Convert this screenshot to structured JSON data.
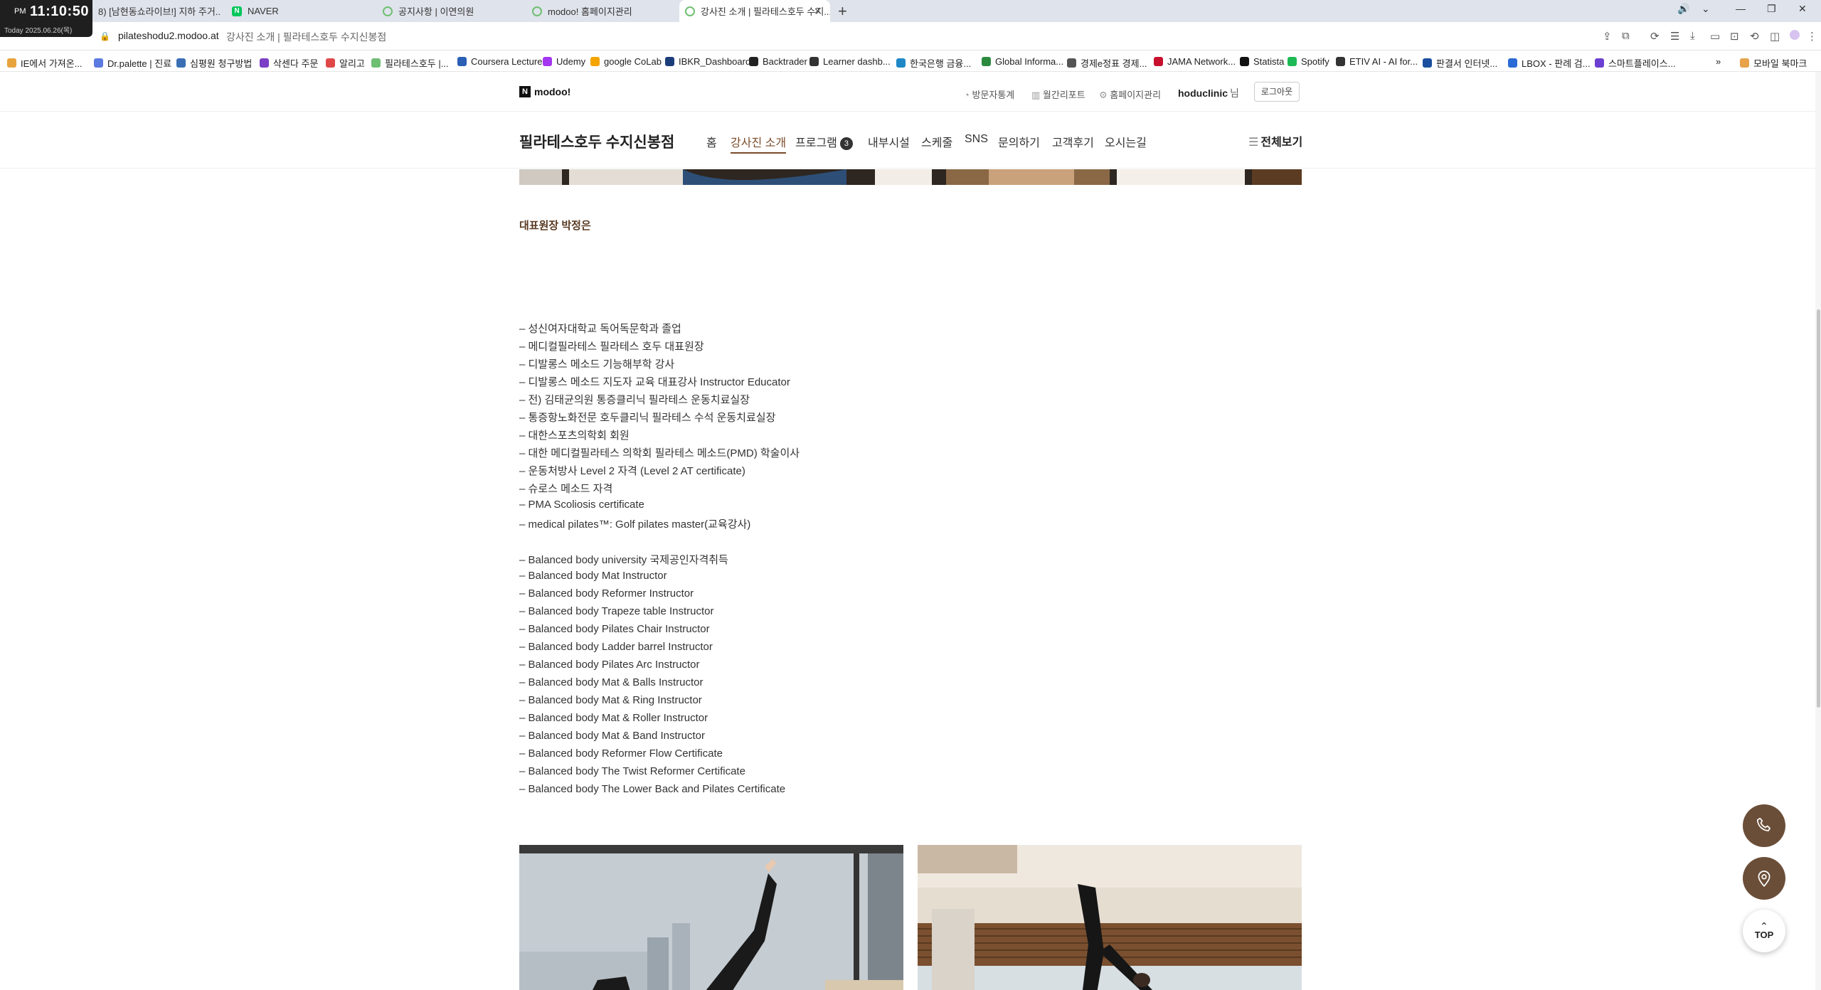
{
  "clock": {
    "ampm": "PM",
    "time": "11:10:50",
    "date": "Today 2025.06.26(목)"
  },
  "tabs": [
    {
      "label": "8) [남현동쇼라이브!] 지하 주거...",
      "active": false
    },
    {
      "label": "NAVER",
      "active": false
    },
    {
      "label": "공지사항 | 이연의원",
      "active": false
    },
    {
      "label": "modoo! 홈페이지관리",
      "active": false
    },
    {
      "label": "강사진 소개 | 필라테스호두 수지...",
      "active": true
    }
  ],
  "address": {
    "url": "pilateshodu2.modoo.at",
    "title": "강사진 소개 | 필라테스호두 수지신봉점"
  },
  "bookmarks": [
    {
      "label": "IE에서 가져온...",
      "color": "#e8a33c"
    },
    {
      "label": "Dr.palette | 진료",
      "color": "#5b7be0"
    },
    {
      "label": "심평원 청구방법",
      "color": "#3a6fb5"
    },
    {
      "label": "삭센다 주문",
      "color": "#7a3ec7"
    },
    {
      "label": "알리고",
      "color": "#e04848"
    },
    {
      "label": "필라테스호두 |...",
      "color": "#6fbf73"
    },
    {
      "label": "Coursera Lecture",
      "color": "#2a5fb5"
    },
    {
      "label": "Udemy",
      "color": "#a435f0"
    },
    {
      "label": "google CoLab",
      "color": "#f4a400"
    },
    {
      "label": "IBKR_Dashboard",
      "color": "#1b3d7a"
    },
    {
      "label": "Backtrader",
      "color": "#222222"
    },
    {
      "label": "Learner dashb...",
      "color": "#333333"
    },
    {
      "label": "한국은행 금융...",
      "color": "#1e88c7"
    },
    {
      "label": "Global Informa...",
      "color": "#2b8a3e"
    },
    {
      "label": "경제e정표 경제...",
      "color": "#555555"
    },
    {
      "label": "JAMA Network...",
      "color": "#c8102e"
    },
    {
      "label": "Statista",
      "color": "#111111"
    },
    {
      "label": "Spotify",
      "color": "#1db954"
    },
    {
      "label": "ETIV AI - AI for...",
      "color": "#333333"
    },
    {
      "label": "판결서 인터넷...",
      "color": "#1a4fa0"
    },
    {
      "label": "LBOX - 판례 검...",
      "color": "#2a6bd6"
    },
    {
      "label": "스마트플레이스...",
      "color": "#6b3fd1"
    }
  ],
  "bookmarks_more": "»",
  "mobile_bookmarks": "모바일 북마크",
  "header": {
    "logo": "modoo!",
    "links": [
      "방문자통계",
      "월간리포트",
      "홈페이지관리"
    ],
    "user": "hoduclinic",
    "user_suffix": "님",
    "logout": "로그아웃"
  },
  "site": {
    "name": "필라테스호두 수지신봉점",
    "nav": [
      {
        "label": "홈",
        "active": false
      },
      {
        "label": "강사진 소개",
        "active": true
      },
      {
        "label": "프로그램",
        "active": false,
        "badge": "3"
      },
      {
        "label": "내부시설",
        "active": false
      },
      {
        "label": "스케줄",
        "active": false
      },
      {
        "label": "SNS",
        "active": false
      },
      {
        "label": "문의하기",
        "active": false
      },
      {
        "label": "고객후기",
        "active": false
      },
      {
        "label": "오시는길",
        "active": false
      }
    ],
    "all_view": "전체보기"
  },
  "instructor": {
    "title": "대표원장 박정은",
    "credentials": [
      "– 성신여자대학교 독어독문학과 졸업",
      "– 메디컬필라테스 필라테스 호두 대표원장",
      "– 디발롱스 메소드 기능해부학 강사",
      "– 디발롱스 메소드 지도자 교육 대표강사 Instructor Educator",
      "– 전) 김태균의원 통증클리닉 필라테스 운동치료실장",
      "– 통증항노화전문 호두클리닉 필라테스 수석 운동치료실장",
      "– 대한스포츠의학회 회원",
      "– 대한 메디컬필라테스 의학회 필라테스 메소드(PMD) 학술이사",
      "– 운동처방사 Level 2 자격 (Level 2 AT certificate)",
      "– 슈로스 메소드 자격",
      "– PMA Scoliosis certificate",
      "– medical pilates™: Golf pilates master(교육강사)",
      "",
      "– Balanced body university 국제공인자격취득",
      "– Balanced body Mat Instructor",
      "– Balanced body Reformer Instructor",
      "– Balanced body Trapeze table Instructor",
      "– Balanced body Pilates Chair Instructor",
      "– Balanced body Ladder barrel Instructor",
      "– Balanced body Pilates Arc Instructor",
      "– Balanced body Mat & Balls Instructor",
      "– Balanced body Mat & Ring Instructor",
      "– Balanced body Mat & Roller Instructor",
      "– Balanced body Mat & Band Instructor",
      "– Balanced body Reformer Flow Certificate",
      "– Balanced body The Twist Reformer Certificate",
      "– Balanced body The Lower Back and Pilates Certificate"
    ]
  },
  "floating": {
    "top_label": "TOP"
  },
  "colors": {
    "accent": "#7a4b2a",
    "fab": "#6b4e38",
    "heading": "#5a3a22"
  }
}
